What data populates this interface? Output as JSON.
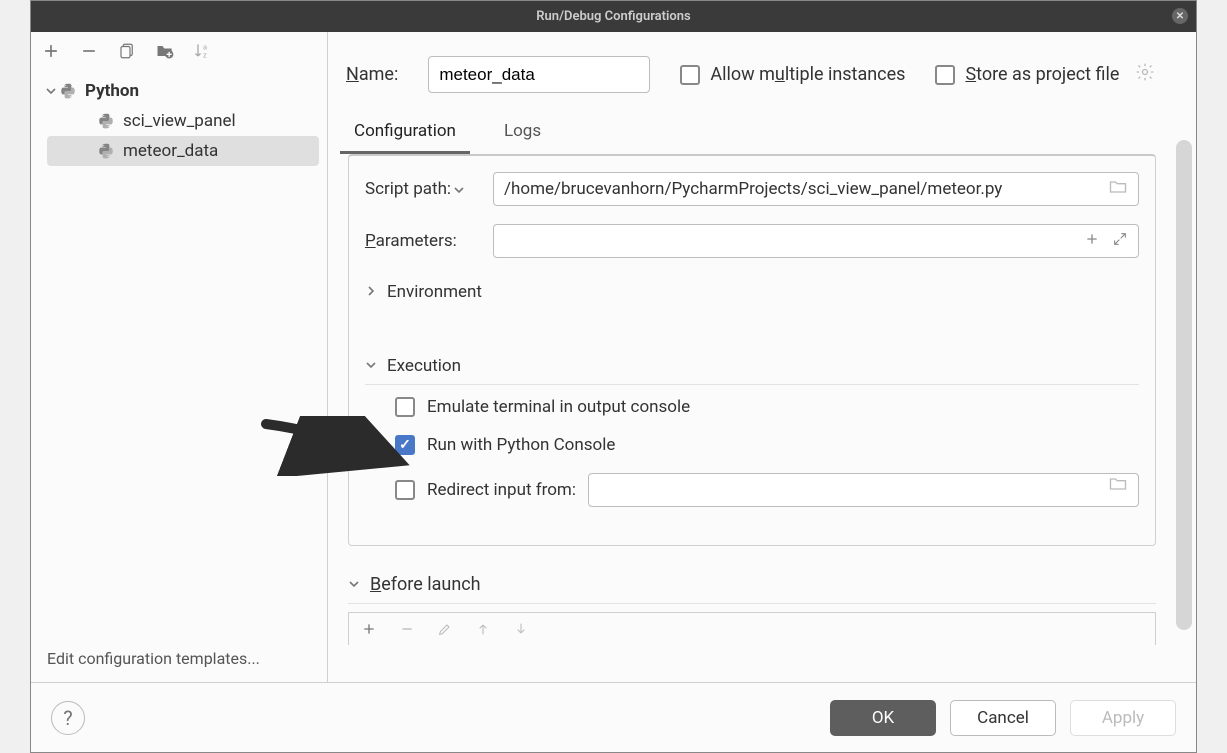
{
  "titlebar": {
    "title": "Run/Debug Configurations"
  },
  "tree": {
    "root_label": "Python",
    "items": [
      {
        "label": "sci_view_panel"
      },
      {
        "label": "meteor_data"
      }
    ]
  },
  "edit_templates": "Edit configuration templates...",
  "name_section": {
    "label_pre": "N",
    "label_post": "ame:",
    "value": "meteor_data",
    "allow_multiple_pre": "Allow m",
    "allow_multiple_u": "u",
    "allow_multiple_post": "ltiple instances",
    "store_pre": "S",
    "store_post": "tore as project file"
  },
  "tabs": {
    "configuration": "Configuration",
    "logs": "Logs"
  },
  "form": {
    "script_path_label": "Script path:",
    "script_path_value": "/home/brucevanhorn/PycharmProjects/sci_view_panel/meteor.py",
    "parameters_label_pre": "P",
    "parameters_label_post": "arameters:",
    "parameters_value": "",
    "environment_label": "Environment",
    "execution_label": "Execution",
    "emulate_terminal": "Emulate terminal in output console",
    "run_python_console": "Run with Python Console",
    "redirect_input_label": "Redirect input from:",
    "redirect_input_value": ""
  },
  "before_launch": {
    "label_pre": "B",
    "label_post": "efore launch"
  },
  "footer": {
    "ok": "OK",
    "cancel": "Cancel",
    "apply": "Apply"
  }
}
